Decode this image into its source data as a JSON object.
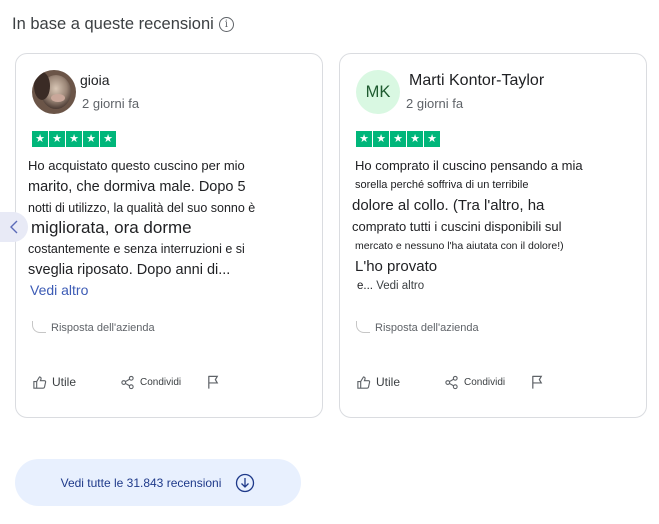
{
  "header": {
    "title": "In base a queste recensioni",
    "info_glyph": "i"
  },
  "reviews": [
    {
      "author": "gioia",
      "date": "2 giorni fa",
      "rating": 5,
      "lines": [
        "Ho acquistato questo cuscino per mio",
        "marito, che dormiva male. Dopo 5",
        "notti di utilizzo, la qualità del suo sonno è",
        "migliorata, ora dorme",
        "costantemente e senza interruzioni e si",
        "sveglia riposato. Dopo anni di..."
      ],
      "more": "Vedi altro",
      "reply": "Risposta dell'azienda",
      "like": "Utile",
      "share": "Condividi"
    },
    {
      "author": "Marti Kontor-Taylor",
      "initials": "MK",
      "date": "2 giorni fa",
      "rating": 5,
      "lines": [
        "Ho comprato il cuscino pensando a mia",
        "sorella perché soffriva di un terribile",
        "dolore al collo. (Tra l'altro, ha",
        "comprato tutti i cuscini disponibili sul",
        "mercato e nessuno l'ha aiutata con il dolore!)",
        "L'ho provato"
      ],
      "ellipsis": "e...",
      "more": "Vedi altro",
      "reply": "Risposta dell'azienda",
      "like": "Utile",
      "share": "Condividi"
    }
  ],
  "footer": {
    "all_reviews": "Vedi tutte le 31.843 recensioni"
  },
  "colors": {
    "star": "#00b67a",
    "link": "#3c5bb5",
    "button_bg": "#e8f0fe",
    "avatar_bg": "#d9f8e2"
  }
}
